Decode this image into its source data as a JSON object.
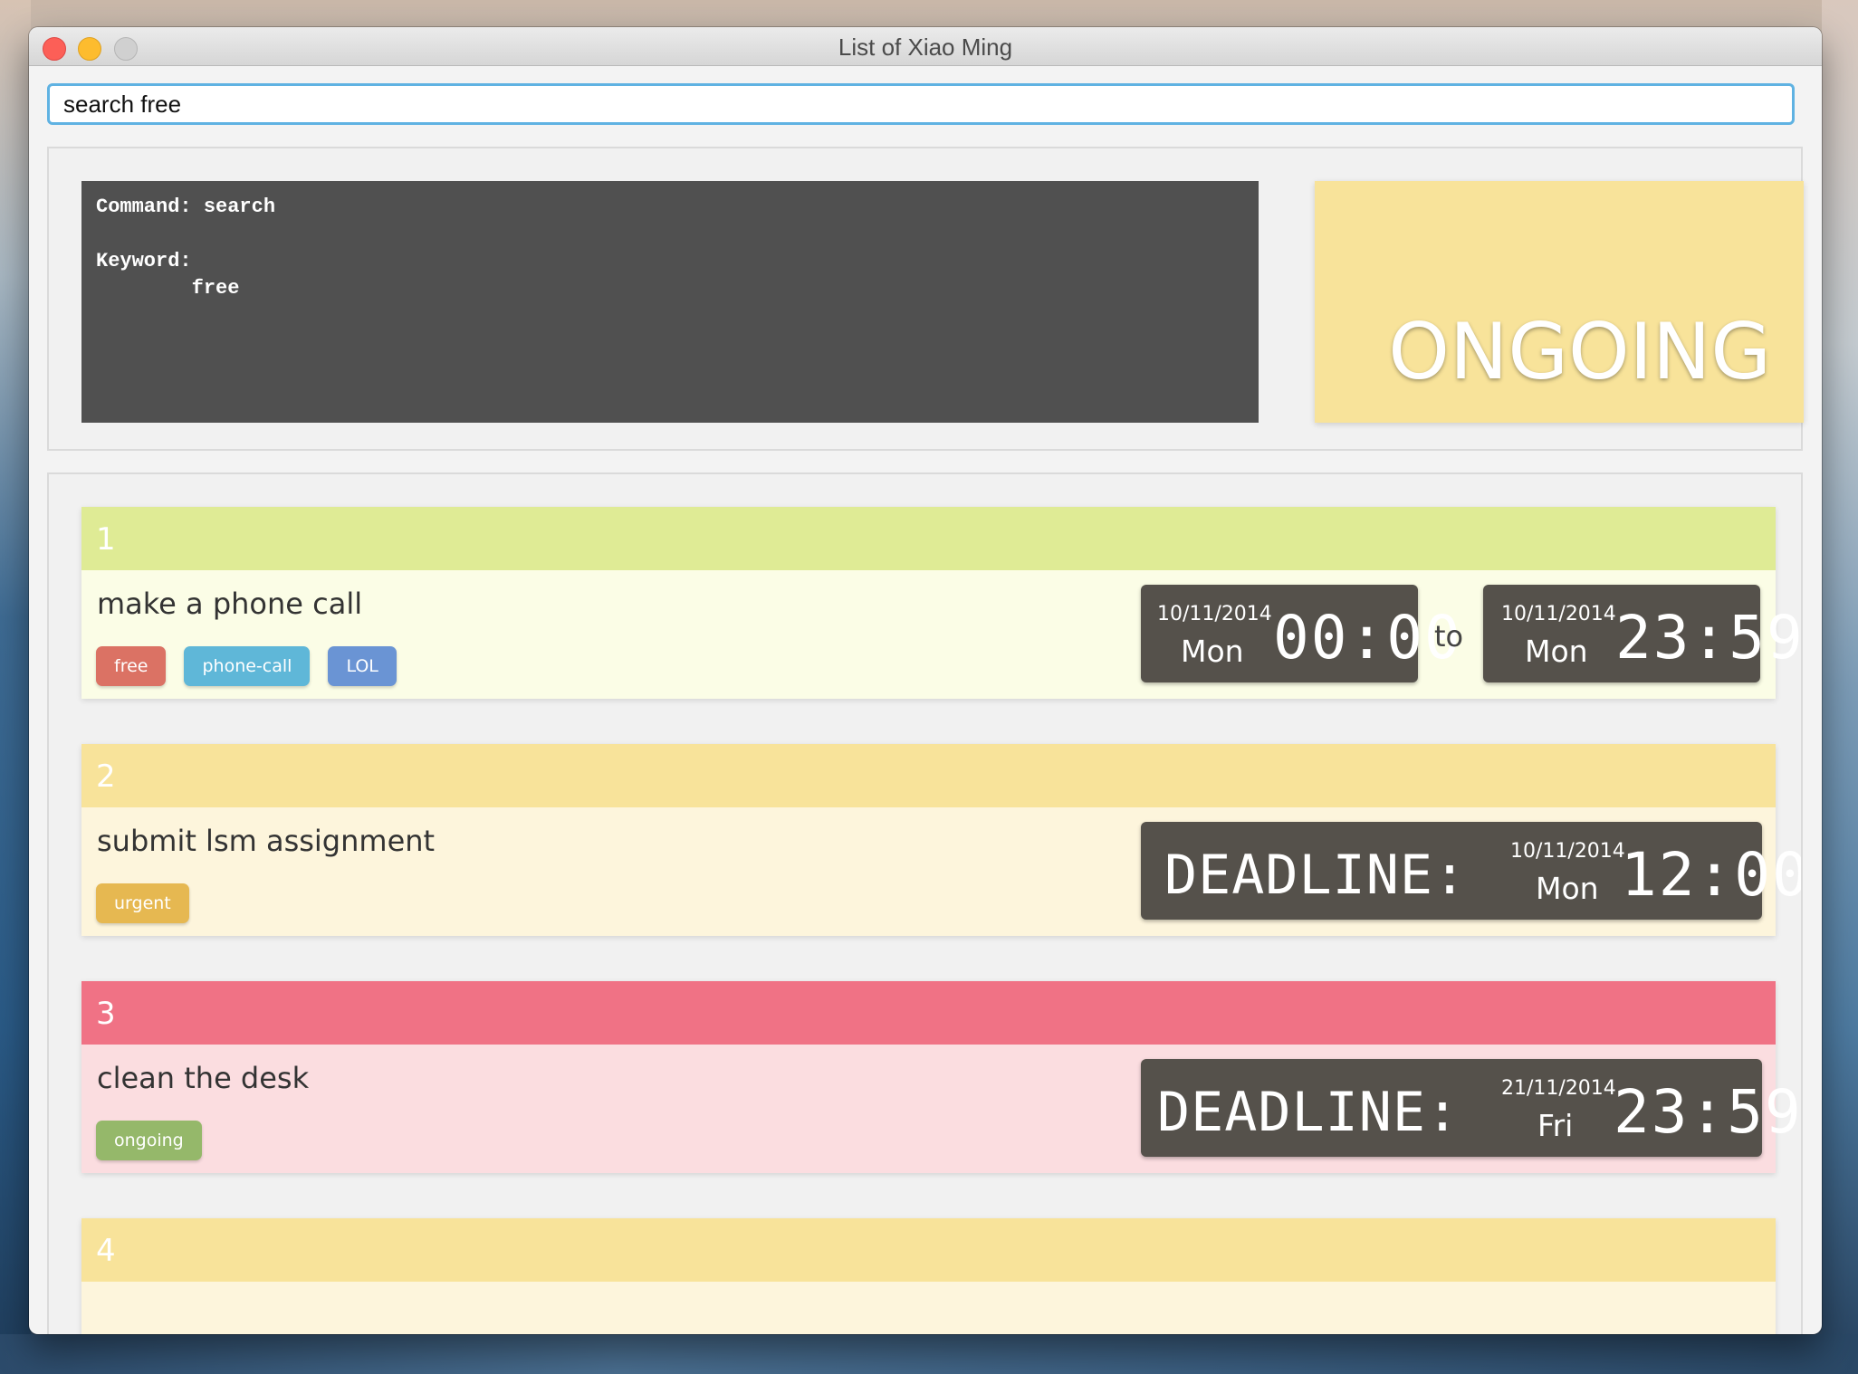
{
  "window": {
    "title": "List of Xiao Ming"
  },
  "search": {
    "value": "search free"
  },
  "console": {
    "command_label": "Command:",
    "command_value": "search",
    "keyword_label": "Keyword:",
    "keyword_value": "free"
  },
  "status": {
    "label": "ONGOING",
    "color": "#f8e39a"
  },
  "tasks": [
    {
      "number": "1",
      "title": "make a phone call",
      "head_color": "#dfeb95",
      "body_color": "#fbfde6",
      "tags": [
        {
          "label": "free",
          "color": "#db7264"
        },
        {
          "label": "phone-call",
          "color": "#5fb7d8"
        },
        {
          "label": "LOL",
          "color": "#6a94d4"
        }
      ],
      "start": {
        "date": "10/11/2014",
        "day": "Mon",
        "time": "00:00"
      },
      "connector": "to",
      "end": {
        "date": "10/11/2014",
        "day": "Mon",
        "time": "23:59"
      }
    },
    {
      "number": "2",
      "title": "submit lsm assignment",
      "head_color": "#f8e39a",
      "body_color": "#fdf5dc",
      "tags": [
        {
          "label": "urgent",
          "color": "#e6b851"
        }
      ],
      "deadline_label": "DEADLINE:",
      "deadline": {
        "date": "10/11/2014",
        "day": "Mon",
        "time": "12:00"
      }
    },
    {
      "number": "3",
      "title": "clean the desk",
      "head_color": "#f07285",
      "body_color": "#fbdde0",
      "tags": [
        {
          "label": "ongoing",
          "color": "#95b86a"
        }
      ],
      "deadline_label": "DEADLINE:",
      "deadline": {
        "date": "21/11/2014",
        "day": "Fri",
        "time": "23:59"
      }
    },
    {
      "number": "4",
      "head_color": "#f8e39a",
      "body_color": "#fdf5dc"
    }
  ]
}
